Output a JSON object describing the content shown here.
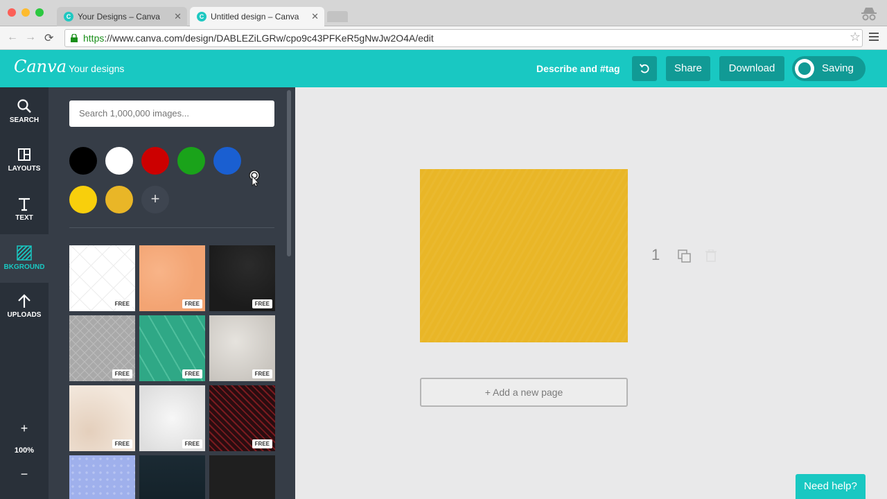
{
  "browser": {
    "tabs": [
      {
        "title": "Your Designs – Canva",
        "active": false
      },
      {
        "title": "Untitled design – Canva",
        "active": true
      }
    ],
    "url": {
      "scheme": "https",
      "rest": "://www.canva.com/design/DABLEZiLGRw/cpo9c43PFKeR5gNwJw2O4A/edit"
    }
  },
  "header": {
    "logo": "Canva",
    "your_designs": "Your designs",
    "describe": "Describe and #tag",
    "share": "Share",
    "download": "Download",
    "saving": "Saving"
  },
  "rail": {
    "items": [
      {
        "label": "SEARCH",
        "icon": "search-icon"
      },
      {
        "label": "LAYOUTS",
        "icon": "layouts-icon"
      },
      {
        "label": "TEXT",
        "icon": "text-icon"
      },
      {
        "label": "BKGROUND",
        "icon": "background-icon",
        "active": true
      },
      {
        "label": "UPLOADS",
        "icon": "upload-icon"
      }
    ],
    "zoom_in": "+",
    "zoom_level": "100%",
    "zoom_out": "−"
  },
  "panel": {
    "search_placeholder": "Search 1,000,000 images...",
    "swatches": [
      "#000000",
      "#ffffff",
      "#cc0000",
      "#1aa31a",
      "#1a5fd1",
      "#f8cf0c",
      "#e9b627"
    ],
    "add_color": "+",
    "free_label": "FREE",
    "thumbnails": [
      {
        "name": "white-diamond",
        "free": true
      },
      {
        "name": "peach-texture",
        "free": true
      },
      {
        "name": "black-texture",
        "free": true
      },
      {
        "name": "grey-grid",
        "free": true
      },
      {
        "name": "green-stripes",
        "free": true
      },
      {
        "name": "stone-texture",
        "free": true
      },
      {
        "name": "cream-paper",
        "free": true
      },
      {
        "name": "white-marble",
        "free": true
      },
      {
        "name": "red-chevron",
        "free": true
      },
      {
        "name": "blue-dots",
        "free": false
      },
      {
        "name": "dark-teal",
        "free": false
      },
      {
        "name": "dark-black",
        "free": false
      }
    ]
  },
  "canvas": {
    "page_number": "1",
    "page_color": "#e9b627",
    "add_page": "+ Add a new page"
  },
  "help": "Need help?",
  "colors": {
    "accent": "#19c8c2",
    "accent_dark": "#119a95",
    "rail_bg": "#293039",
    "panel_bg": "#363d47"
  }
}
